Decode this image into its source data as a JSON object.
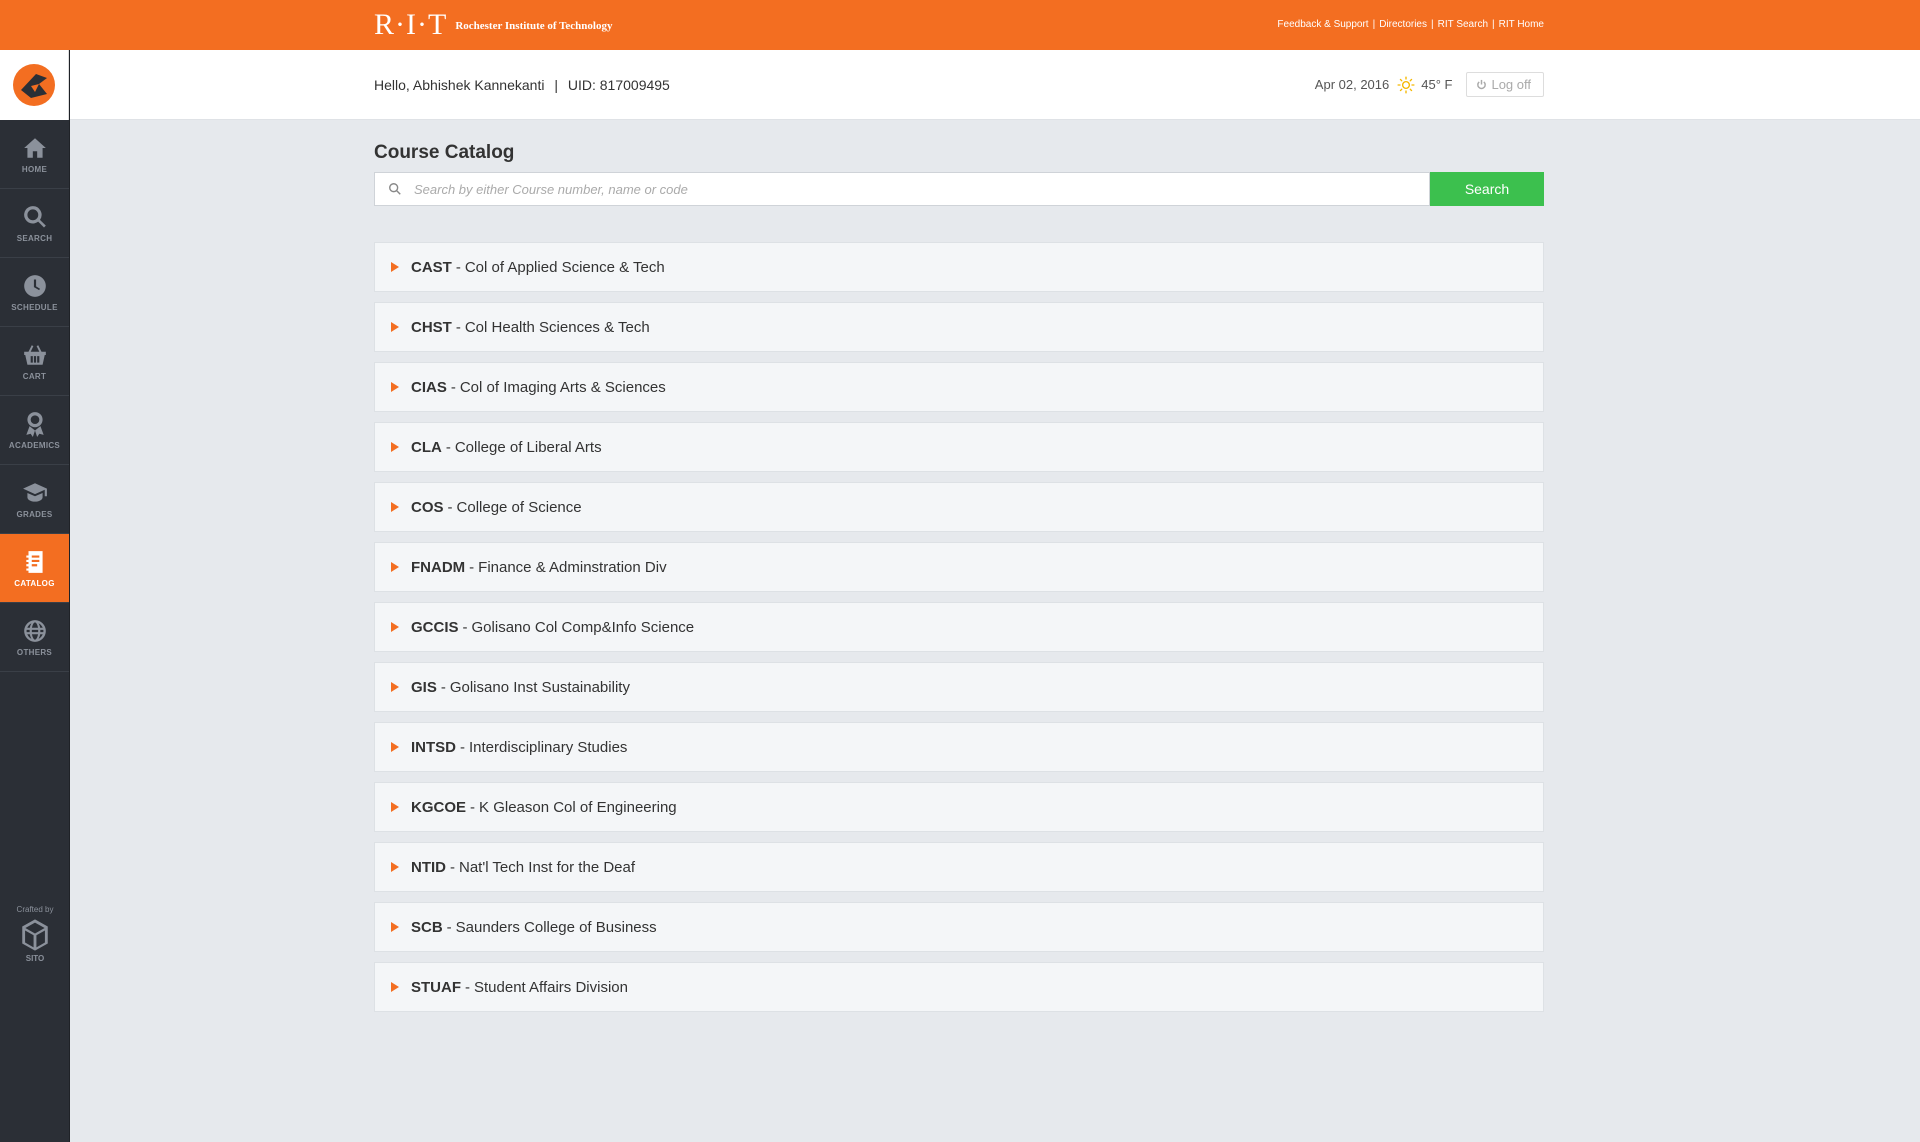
{
  "brand": {
    "mark": "R·I·T",
    "name": "Rochester Institute of Technology",
    "color": "#f36e21"
  },
  "top_links": [
    "Feedback & Support",
    "Directories",
    "RIT Search",
    "RIT Home"
  ],
  "user": {
    "greeting": "Hello, Abhishek Kannekanti",
    "uid": "UID: 817009495"
  },
  "header": {
    "date": "Apr 02, 2016",
    "temperature": "45° F",
    "weather_icon": "sun-icon",
    "logoff_label": "Log off"
  },
  "sidebar": {
    "items": [
      {
        "label": "HOME",
        "icon": "home-icon",
        "active": false
      },
      {
        "label": "SEARCH",
        "icon": "search-icon",
        "active": false
      },
      {
        "label": "SCHEDULE",
        "icon": "clock-icon",
        "active": false
      },
      {
        "label": "CART",
        "icon": "basket-icon",
        "active": false
      },
      {
        "label": "ACADEMICS",
        "icon": "award-icon",
        "active": false
      },
      {
        "label": "GRADES",
        "icon": "graduation-cap-icon",
        "active": false
      },
      {
        "label": "CATALOG",
        "icon": "notebook-icon",
        "active": true
      },
      {
        "label": "OTHERS",
        "icon": "globe-icon",
        "active": false
      }
    ],
    "crafted_by": "Crafted by",
    "crafted_name": "SITO"
  },
  "main": {
    "title": "Course Catalog",
    "search_placeholder": "Search by either Course number, name or code",
    "search_button": "Search",
    "colleges": [
      {
        "code": "CAST",
        "name": "Col of Applied Science & Tech"
      },
      {
        "code": "CHST",
        "name": "Col Health Sciences & Tech"
      },
      {
        "code": "CIAS",
        "name": "Col of Imaging Arts & Sciences"
      },
      {
        "code": "CLA",
        "name": "College of Liberal Arts"
      },
      {
        "code": "COS",
        "name": "College of Science"
      },
      {
        "code": "FNADM",
        "name": "Finance & Adminstration Div"
      },
      {
        "code": "GCCIS",
        "name": "Golisano Col Comp&Info Science"
      },
      {
        "code": "GIS",
        "name": "Golisano Inst Sustainability"
      },
      {
        "code": "INTSD",
        "name": "Interdisciplinary Studies"
      },
      {
        "code": "KGCOE",
        "name": "K Gleason Col of Engineering"
      },
      {
        "code": "NTID",
        "name": "Nat'l Tech Inst for the Deaf"
      },
      {
        "code": "SCB",
        "name": "Saunders College of Business"
      },
      {
        "code": "STUAF",
        "name": "Student Affairs Division"
      }
    ]
  },
  "colors": {
    "accent": "#f36e21",
    "search_button": "#3cc04e",
    "sidebar_bg": "#2b2f36"
  }
}
